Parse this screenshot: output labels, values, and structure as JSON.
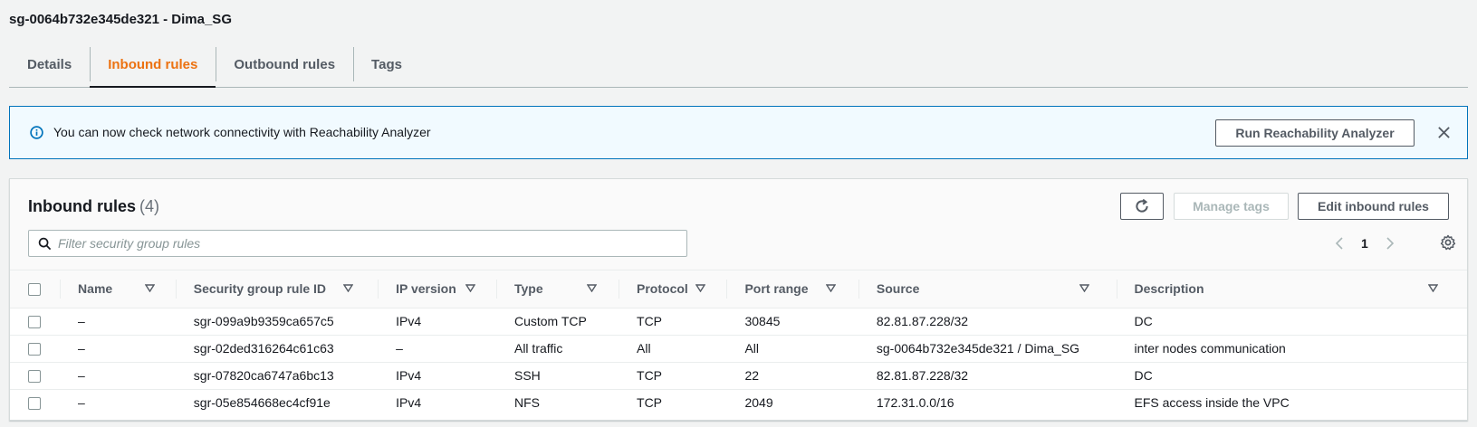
{
  "page": {
    "title": "sg-0064b732e345de321 - Dima_SG"
  },
  "tabs": [
    {
      "label": "Details",
      "active": false
    },
    {
      "label": "Inbound rules",
      "active": true
    },
    {
      "label": "Outbound rules",
      "active": false
    },
    {
      "label": "Tags",
      "active": false
    }
  ],
  "alert": {
    "icon": "info-icon",
    "text": "You can now check network connectivity with Reachability Analyzer",
    "button_label": "Run Reachability Analyzer",
    "close_icon": "close-icon"
  },
  "panel": {
    "title": "Inbound rules",
    "count": "(4)",
    "manage_tags_label": "Manage tags",
    "edit_label": "Edit inbound rules",
    "search_placeholder": "Filter security group rules",
    "search_value": "",
    "page_number": "1"
  },
  "table": {
    "columns": [
      "Name",
      "Security group rule ID",
      "IP version",
      "Type",
      "Protocol",
      "Port range",
      "Source",
      "Description"
    ],
    "rows": [
      [
        "–",
        "sgr-099a9b9359ca657c5",
        "IPv4",
        "Custom TCP",
        "TCP",
        "30845",
        "82.81.87.228/32",
        "DC"
      ],
      [
        "–",
        "sgr-02ded316264c61c63",
        "–",
        "All traffic",
        "All",
        "All",
        "sg-0064b732e345de321 / Dima_SG",
        "inter nodes communication"
      ],
      [
        "–",
        "sgr-07820ca6747a6bc13",
        "IPv4",
        "SSH",
        "TCP",
        "22",
        "82.81.87.228/32",
        "DC"
      ],
      [
        "–",
        "sgr-05e854668ec4cf91e",
        "IPv4",
        "NFS",
        "TCP",
        "2049",
        "172.31.0.0/16",
        "EFS access inside the VPC"
      ]
    ]
  },
  "colors": {
    "active_tab": "#ec7211",
    "alert_background": "#f1faff",
    "alert_border": "#0073bb"
  }
}
